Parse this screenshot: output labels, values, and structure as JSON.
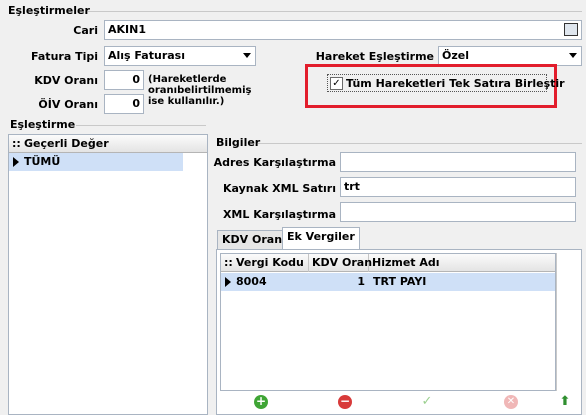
{
  "sections": {
    "mappings_title": "Eşleştirmeler",
    "mapping_title": "Eşleştirme",
    "info_title": "Bilgiler"
  },
  "form": {
    "cari_label": "Cari",
    "cari_value": "AKIN1",
    "invoice_type_label": "Fatura Tipi",
    "invoice_type_value": "Alış Faturası",
    "vat_rate_label": "KDV Oranı",
    "vat_rate_value": "0",
    "oiv_rate_label": "ÖİV Oranı",
    "oiv_rate_value": "0",
    "rate_note": "(Hareketlerde oranıbelirtilmemiş ise kullanılır.)",
    "movement_match_label": "Hareket Eşleştirme",
    "movement_match_value": "Özel",
    "merge_checkbox_label": "Tüm Hareketleri Tek Satıra Birleştir",
    "merge_checked": true
  },
  "mapping_grid": {
    "header": "Geçerli Değer",
    "rows": [
      "TÜMÜ"
    ]
  },
  "info": {
    "address_match_label": "Adres Karşılaştırma",
    "address_match_value": "",
    "source_xml_row_label": "Kaynak XML Satırı",
    "source_xml_row_value": "trt",
    "xml_compare_label": "XML Karşılaştırma",
    "xml_compare_value": ""
  },
  "tabs": [
    "KDV Oranı",
    "Ek Vergiler"
  ],
  "active_tab": "Ek Vergiler",
  "tax_grid": {
    "columns": [
      "Vergi Kodu",
      "KDV Oranı",
      "Hizmet Adı"
    ],
    "rows": [
      {
        "code": "8004",
        "vat": "1",
        "service": "TRT PAYI"
      }
    ]
  },
  "nav_buttons": [
    "add-icon",
    "remove-icon",
    "confirm-icon",
    "cancel-icon",
    "move-up-icon"
  ],
  "colors": {
    "highlight_border": "#e21d2c",
    "selection": "#cfe0f7",
    "add": "#3fa535",
    "remove": "#d83a3a",
    "up": "#2f8f2f"
  }
}
